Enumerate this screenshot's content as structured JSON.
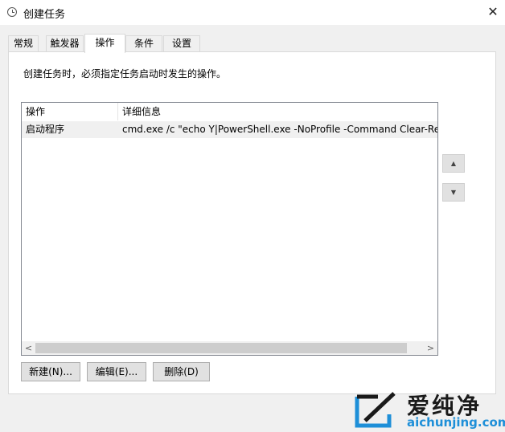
{
  "window": {
    "title": "创建任务",
    "close_glyph": "✕",
    "icon": "clock-icon"
  },
  "tabs": [
    {
      "label": "常规",
      "active": false
    },
    {
      "label": "触发器",
      "active": false
    },
    {
      "label": "操作",
      "active": true
    },
    {
      "label": "条件",
      "active": false
    },
    {
      "label": "设置",
      "active": false
    }
  ],
  "panel": {
    "description": "创建任务时，必须指定任务启动时发生的操作。",
    "table": {
      "columns": [
        "操作",
        "详细信息"
      ],
      "rows": [
        {
          "action": "启动程序",
          "details": "cmd.exe /c  \"echo Y|PowerShell.exe -NoProfile -Command Clear-RecycleBin\""
        }
      ]
    },
    "scroll": {
      "left_glyph": "<",
      "right_glyph": ">"
    },
    "move_up_glyph": "▲",
    "move_down_glyph": "▼",
    "buttons": {
      "new": "新建(N)...",
      "edit": "编辑(E)...",
      "delete": "删除(D)"
    }
  },
  "watermark": {
    "brand_cn": "爱纯净",
    "brand_url": "aichunjing.com",
    "accent": "#1e8fd8"
  }
}
